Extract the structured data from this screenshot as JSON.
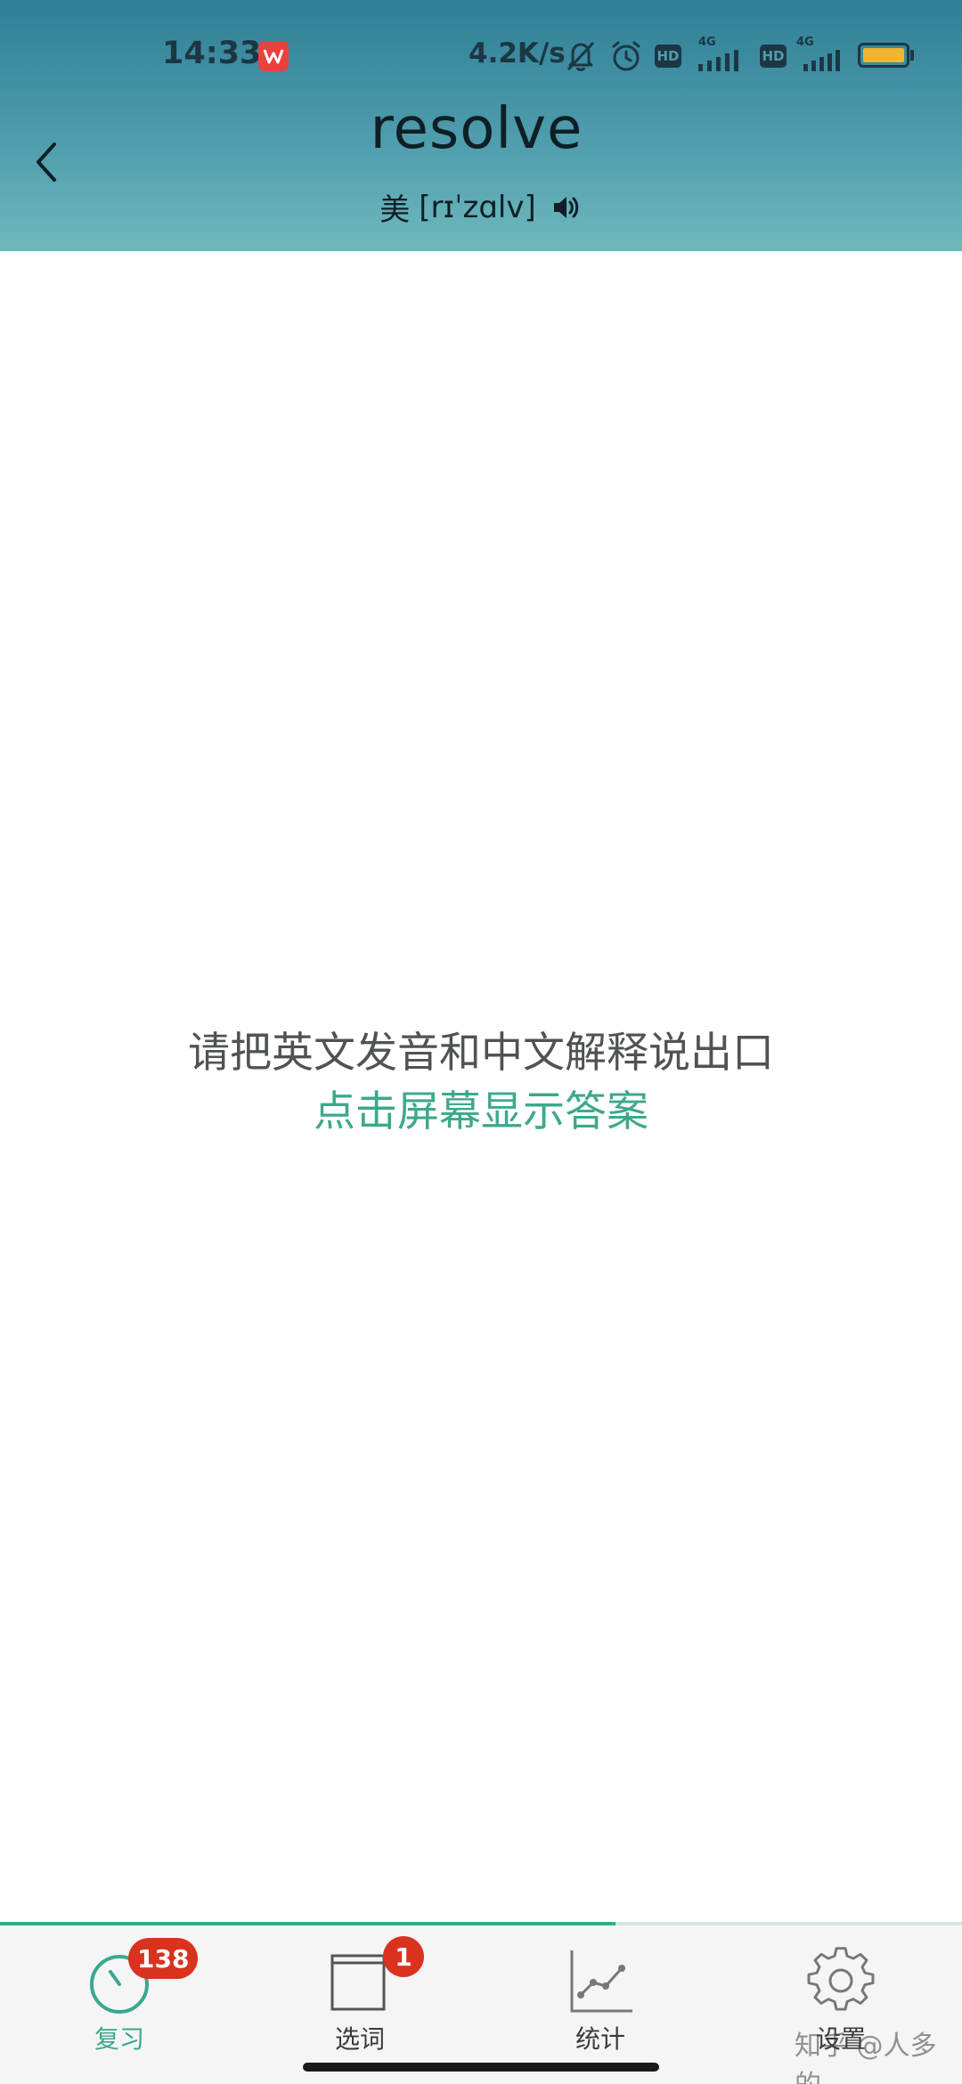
{
  "status_bar": {
    "time": "14:33",
    "net_speed": "4.2K/s",
    "sim1_network": "4G",
    "sim2_network": "4G",
    "hd_label": "HD",
    "icons": [
      "wps-office-icon",
      "bell-off-icon",
      "alarm-icon",
      "hd-icon",
      "signal-icon",
      "hd-icon",
      "signal-icon",
      "battery-icon"
    ]
  },
  "header": {
    "word": "resolve",
    "phonetic_region": "美",
    "phonetic": "[rɪˈzɑlv]",
    "colors": {
      "gradient_top": "#2f7f97",
      "gradient_bottom": "#6fb8bd"
    }
  },
  "main": {
    "instruction": "请把英文发音和中文解释说出口",
    "tap_hint": "点击屏幕显示答案"
  },
  "bottom_nav": {
    "progress_fraction": 0.64,
    "items": [
      {
        "label": "复习",
        "icon": "timer-icon",
        "badge": "138",
        "active": true
      },
      {
        "label": "选词",
        "icon": "window-icon",
        "badge": "1",
        "active": false
      },
      {
        "label": "统计",
        "icon": "line-chart-icon",
        "badge": "",
        "active": false
      },
      {
        "label": "设置",
        "icon": "gear-icon",
        "badge": "",
        "active": false
      }
    ],
    "colors": {
      "accent": "#3aa88c",
      "badge": "#d9321f"
    }
  },
  "watermark": "知乎 @人多的"
}
